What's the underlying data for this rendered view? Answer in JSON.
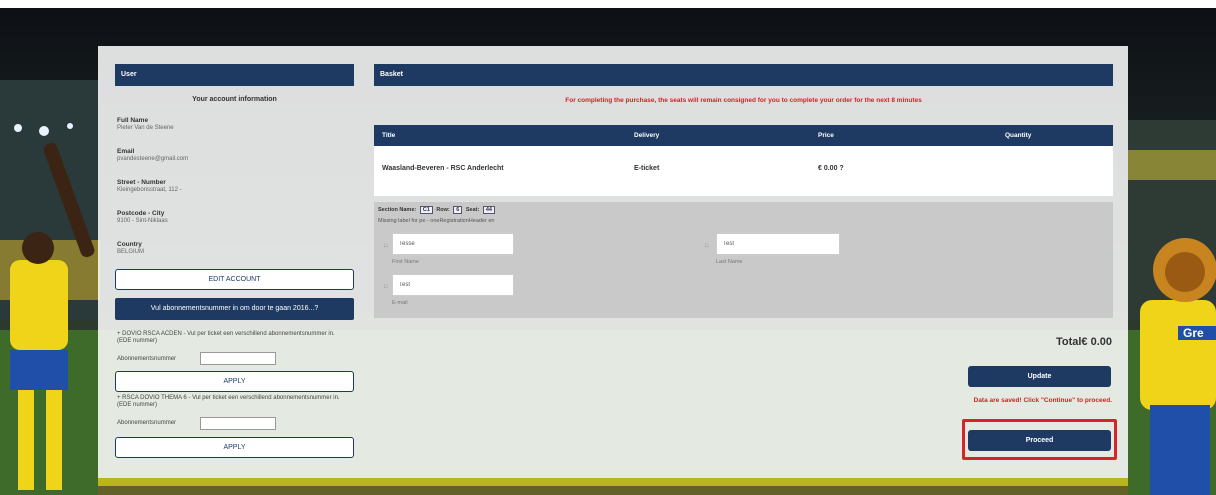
{
  "user": {
    "header": "User",
    "account_title": "Your account information",
    "fields": [
      {
        "label": "Full Name",
        "value": "Pieter Van de Steene"
      },
      {
        "label": "Email",
        "value": "pvandesteene@gmail.com"
      },
      {
        "label": "Street - Number",
        "value": "Kleingebonsstraat, 112 -"
      },
      {
        "label": "Postcode - City",
        "value": "9100 - Sint-Niklaas"
      },
      {
        "label": "Country",
        "value": "BELGIUM"
      }
    ],
    "edit_account_label": "EDIT ACCOUNT",
    "subscription_banner": "Vul abonnementsnummer in om door te gaan 2016...?",
    "promo1_text": "+ DOVIO RSCA ACDEN - Vul per ticket een verschillend abonnementsnummer in. (EDE nummer)",
    "promo1_field_label": "Abonnementsnummer",
    "apply_label": "APPLY",
    "promo2_text": "+ RSCA DOVIO THEMA 6 - Vul per ticket een verschillend abonnementsnummer in. (EDE nummer)",
    "promo2_field_label": "Abonnementsnummer"
  },
  "basket": {
    "header": "Basket",
    "notice": "For completing the purchase, the seats will remain consigned for you to complete your order for the next 8 minutes",
    "columns": [
      "Title",
      "Delivery",
      "Price",
      "Quantity"
    ],
    "row": {
      "title": "Waasland-Beveren - RSC Anderlecht",
      "delivery": "E-ticket",
      "price": "€ 0.00 ?"
    },
    "seat": {
      "section_label": "Section Name:",
      "section_value": "C1",
      "row_label": "Row:",
      "row_value": "6",
      "seat_label": "Seat:",
      "seat_value": "44"
    },
    "missing_label": "Missing label for pe - oneRegistrationHeader en",
    "first_name": {
      "value": "Tesse",
      "caption": "First Name"
    },
    "last_name": {
      "value": "Test",
      "caption": "Last Name"
    },
    "email": {
      "value": "Test",
      "caption": "E-mail"
    },
    "total": "Total€ 0.00",
    "update_label": "Update",
    "saved_notice": "Data are saved! Click \"Continue\" to proceed.",
    "proceed_label": "Proceed"
  },
  "background": {
    "right_sign_text": "Gre"
  },
  "colors": {
    "navy": "#1e3a63",
    "alert_red": "#d22222",
    "highlight_red": "#d8232a"
  }
}
